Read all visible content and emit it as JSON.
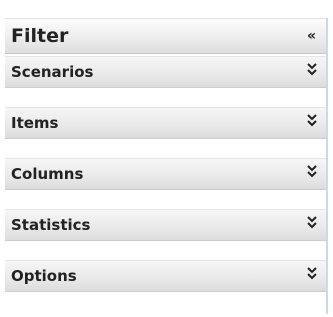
{
  "filter_panel": {
    "title": "Filter",
    "collapse_icon": "double-chevron-left-icon",
    "collapse_glyph": "«",
    "sections": [
      {
        "label": "Scenarios",
        "icon": "double-chevron-down-icon"
      },
      {
        "label": "Items",
        "icon": "double-chevron-down-icon"
      },
      {
        "label": "Columns",
        "icon": "double-chevron-down-icon"
      },
      {
        "label": "Statistics",
        "icon": "double-chevron-down-icon"
      },
      {
        "label": "Options",
        "icon": "double-chevron-down-icon"
      }
    ]
  },
  "colors": {
    "text": "#222222",
    "panel_border": "#c9daea"
  }
}
